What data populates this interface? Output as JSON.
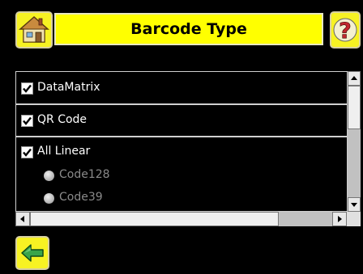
{
  "header": {
    "title": "Barcode Type",
    "help_glyph": "?"
  },
  "barcode_list": {
    "items": [
      {
        "label": "DataMatrix",
        "checked": true
      },
      {
        "label": "QR Code",
        "checked": true
      },
      {
        "label": "All Linear",
        "checked": true,
        "options": [
          {
            "label": "Code128"
          },
          {
            "label": "Code39"
          }
        ]
      }
    ]
  },
  "icons": {
    "home": "home-icon",
    "help": "question-icon",
    "back": "back-arrow-icon"
  },
  "colors": {
    "accent": "#ffff00",
    "button": "#f7f223",
    "background": "#000000",
    "disabled_text": "#8a8a8a"
  }
}
